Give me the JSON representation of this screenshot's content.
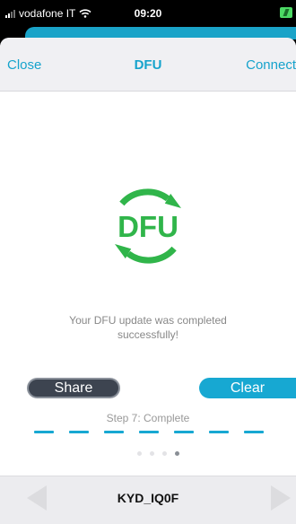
{
  "status_bar": {
    "carrier": "vodafone IT",
    "time": "09:20"
  },
  "nav": {
    "left_label": "Close",
    "title": "DFU",
    "right_label": "Connect"
  },
  "logo": {
    "text": "DFU",
    "icon": "dfu-refresh-icon"
  },
  "message": "Your DFU update was completed successfully!",
  "actions": {
    "share_label": "Share",
    "clear_label": "Clear"
  },
  "progress": {
    "step_label": "Step 7: Complete",
    "segments_total": 7,
    "segments_complete": 7
  },
  "pager": {
    "pages": 4,
    "current_page": 4
  },
  "footer": {
    "device_name": "KYD_IQ0F"
  },
  "colors": {
    "accent": "#17a8d2",
    "logo_green": "#30b54a",
    "share_dark": "#3d4450"
  }
}
